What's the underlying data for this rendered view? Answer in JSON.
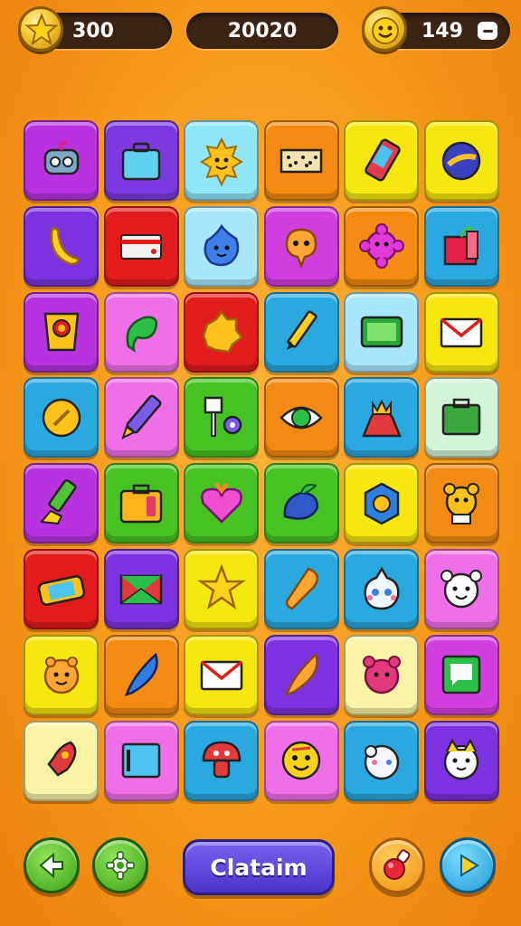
{
  "hud": {
    "stars": "300",
    "score": "20020",
    "coins": "149"
  },
  "board": {
    "rows": 8,
    "cols": 6,
    "tiles": [
      {
        "color": "#b832e0",
        "icon": "robot-icon"
      },
      {
        "color": "#7a3ae0",
        "icon": "briefcase-icon"
      },
      {
        "color": "#8fe6f7",
        "icon": "sun-face-icon"
      },
      {
        "color": "#f38a12",
        "icon": "film-strip-icon"
      },
      {
        "color": "#f6e70f",
        "icon": "phone-icon"
      },
      {
        "color": "#f6e70f",
        "icon": "planet-icon"
      },
      {
        "color": "#7c32e0",
        "icon": "banana-icon"
      },
      {
        "color": "#e21b1b",
        "icon": "card-icon"
      },
      {
        "color": "#a6e7fa",
        "icon": "blue-blob-icon"
      },
      {
        "color": "#d13ee0",
        "icon": "orange-blob-icon"
      },
      {
        "color": "#f38a12",
        "icon": "pink-flower-icon"
      },
      {
        "color": "#2aa8e0",
        "icon": "gift-box-icon"
      },
      {
        "color": "#b832e0",
        "icon": "badge-icon"
      },
      {
        "color": "#ee6fe8",
        "icon": "green-leaf-icon"
      },
      {
        "color": "#e21b1b",
        "icon": "yellow-blob-icon"
      },
      {
        "color": "#2aa8e0",
        "icon": "pencil-icon"
      },
      {
        "color": "#a6e7fa",
        "icon": "tablet-icon"
      },
      {
        "color": "#f6e70f",
        "icon": "envelope-icon"
      },
      {
        "color": "#2aa8e0",
        "icon": "yellow-coin-icon"
      },
      {
        "color": "#ee6fe8",
        "icon": "purple-crayon-icon"
      },
      {
        "color": "#46c323",
        "icon": "sign-gear-icon"
      },
      {
        "color": "#f38a12",
        "icon": "eye-icon"
      },
      {
        "color": "#2aa8e0",
        "icon": "crown-dress-icon"
      },
      {
        "color": "#d4f4da",
        "icon": "green-case-icon"
      },
      {
        "color": "#b832e0",
        "icon": "green-marker-icon"
      },
      {
        "color": "#46c323",
        "icon": "suitcase-icon"
      },
      {
        "color": "#46c323",
        "icon": "heart-icon"
      },
      {
        "color": "#46c323",
        "icon": "blueberry-icon"
      },
      {
        "color": "#f6e70f",
        "icon": "hexagon-icon"
      },
      {
        "color": "#f38a12",
        "icon": "bear-icon"
      },
      {
        "color": "#e21b1b",
        "icon": "game-console-icon"
      },
      {
        "color": "#7c32e0",
        "icon": "green-envelope-icon"
      },
      {
        "color": "#f6e70f",
        "icon": "star-icon"
      },
      {
        "color": "#2aa8e0",
        "icon": "carrot-icon"
      },
      {
        "color": "#2aa8e0",
        "icon": "ghost-icon"
      },
      {
        "color": "#ee6fe8",
        "icon": "puppy-icon"
      },
      {
        "color": "#f6e70f",
        "icon": "orange-critter-icon"
      },
      {
        "color": "#f38a12",
        "icon": "blue-feather-icon"
      },
      {
        "color": "#f6e70f",
        "icon": "mail-icon"
      },
      {
        "color": "#7c32e0",
        "icon": "orange-feather-icon"
      },
      {
        "color": "#f8f3a5",
        "icon": "pink-bear-icon"
      },
      {
        "color": "#d13ee0",
        "icon": "chat-card-icon"
      },
      {
        "color": "#f8f3a5",
        "icon": "red-rocket-icon"
      },
      {
        "color": "#ee6fe8",
        "icon": "blue-tablet-icon"
      },
      {
        "color": "#2aa8e0",
        "icon": "red-mushroom-icon"
      },
      {
        "color": "#ee6fe8",
        "icon": "smiley-icon"
      },
      {
        "color": "#2aa8e0",
        "icon": "white-puff-icon"
      },
      {
        "color": "#7c32e0",
        "icon": "white-cat-icon"
      }
    ]
  },
  "footer": {
    "claim_label": "Clataim",
    "back_icon": "back-arrow-icon",
    "settings_icon": "gear-icon",
    "potion_icon": "potion-icon",
    "play_icon": "play-icon"
  }
}
